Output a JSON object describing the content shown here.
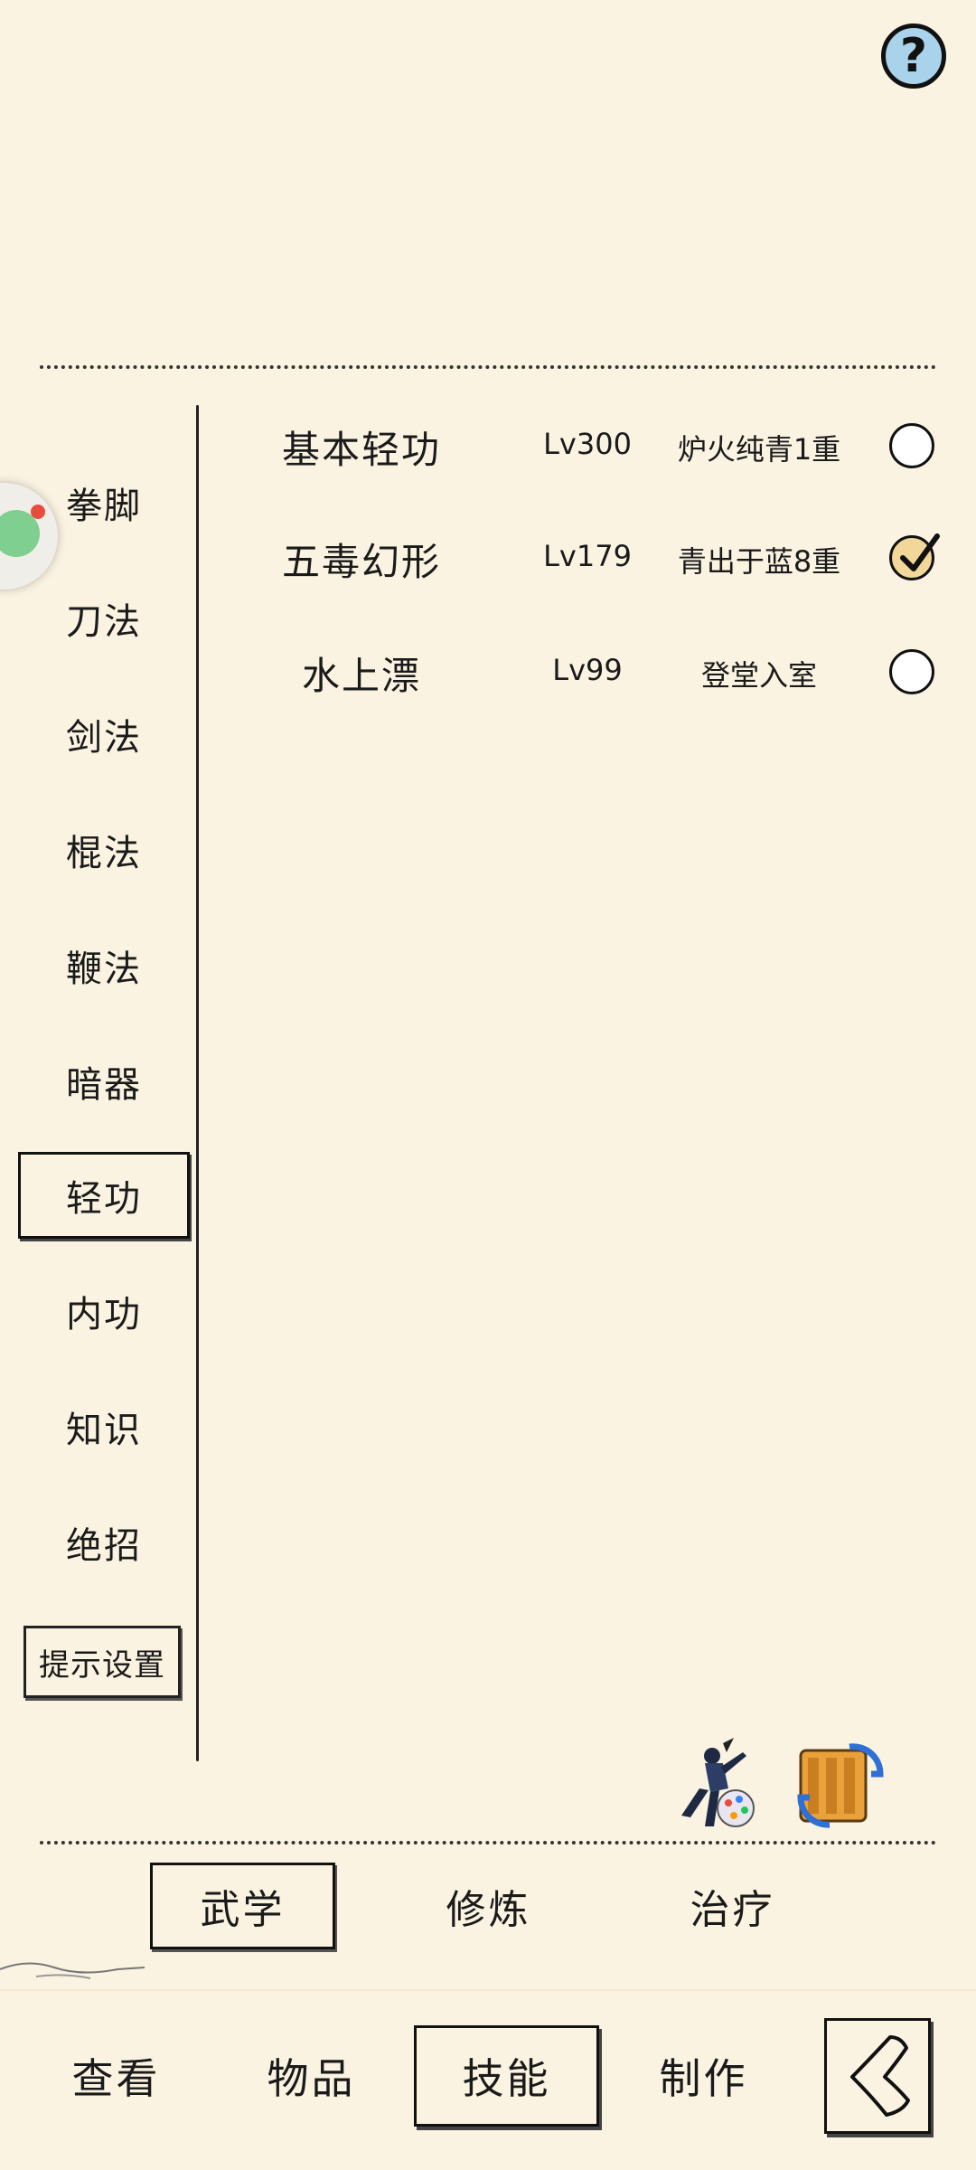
{
  "help": {
    "label": "?"
  },
  "categories": [
    {
      "label": "拳脚",
      "active": false
    },
    {
      "label": "刀法",
      "active": false
    },
    {
      "label": "剑法",
      "active": false
    },
    {
      "label": "棍法",
      "active": false
    },
    {
      "label": "鞭法",
      "active": false
    },
    {
      "label": "暗器",
      "active": false
    },
    {
      "label": "轻功",
      "active": true
    },
    {
      "label": "内功",
      "active": false
    },
    {
      "label": "知识",
      "active": false
    },
    {
      "label": "绝招",
      "active": false
    }
  ],
  "hint_settings": {
    "label": "提示设置"
  },
  "skills": [
    {
      "name": "基本轻功",
      "level": "Lv300",
      "state": "炉火纯青1重",
      "selected": false
    },
    {
      "name": "五毒幻形",
      "level": "Lv179",
      "state": "青出于蓝8重",
      "selected": true
    },
    {
      "name": "水上漂",
      "level": "Lv99",
      "state": "登堂入室",
      "selected": false
    }
  ],
  "icons": {
    "practice": "ninja-fighter-icon",
    "exchange": "scroll-exchange-icon"
  },
  "subtabs": [
    {
      "label": "武学",
      "active": true
    },
    {
      "label": "修炼",
      "active": false
    },
    {
      "label": "治疗",
      "active": false
    }
  ],
  "nav": [
    {
      "label": "查看",
      "active": false
    },
    {
      "label": "物品",
      "active": false
    },
    {
      "label": "技能",
      "active": true
    },
    {
      "label": "制作",
      "active": false
    }
  ],
  "colors": {
    "background": "#fbf3e2",
    "help_button": "#a9d3ea",
    "check_fill": "#f1d79a",
    "avatar_green": "#7fcf90",
    "notification_red": "#e74c3c"
  }
}
